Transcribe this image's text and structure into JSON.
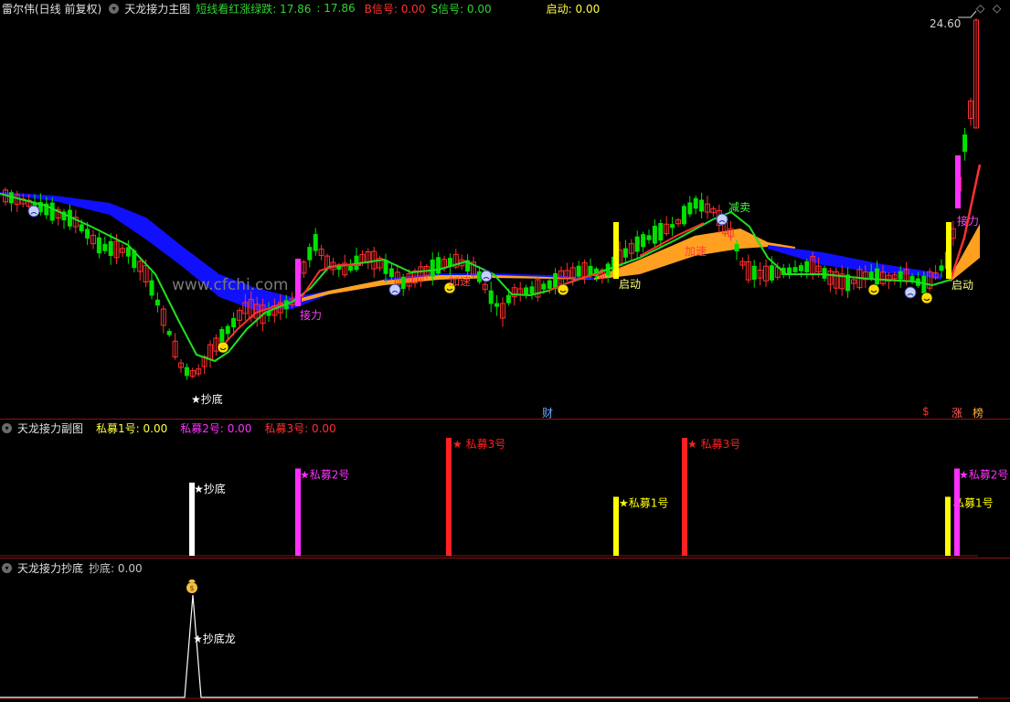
{
  "main": {
    "stock_name": "雷尔伟(日线 前复权)",
    "indicator": "天龙接力主图",
    "legend": [
      {
        "label": "短线看红涨绿跌: 17.86",
        "color": "#2fd62f"
      },
      {
        "label": ": 17.86",
        "color": "#2fd62f"
      },
      {
        "label": "B信号: 0.00",
        "color": "#ff3030"
      },
      {
        "label": "S信号: 0.00",
        "color": "#2fd62f"
      },
      {
        "label": "启动: 0.00",
        "color": "#ffff40"
      }
    ],
    "price_high_label": "24.60",
    "watermark": "www.cfchi.com",
    "annotations": {
      "chaodi": "★抄底",
      "jieli_1": "接力",
      "jieli_2": "接力",
      "qidong_1": "启动",
      "qidong_2": "启动",
      "jiasu": "加速",
      "jianmai": "减卖",
      "yuzhi": "加速"
    },
    "bottom_badges": [
      {
        "text": "财",
        "color": "#6aa8ff"
      },
      {
        "text": "$",
        "color": "#ff3030"
      },
      {
        "text": "涨",
        "color": "#ff6060"
      },
      {
        "text": "榜",
        "color": "#ffb040"
      }
    ]
  },
  "sub1": {
    "indicator": "天龙接力副图",
    "legend": [
      {
        "label": "私募1号: 0.00",
        "color": "#ffff40"
      },
      {
        "label": "私募2号: 0.00",
        "color": "#ff30ff"
      },
      {
        "label": "私募3号: 0.00",
        "color": "#ff3030"
      }
    ],
    "bars": [
      {
        "label": "★抄底",
        "color": "#ffffff",
        "value": 0.62
      },
      {
        "label": "★私募2号",
        "color": "#ff30ff",
        "value": 0.74
      },
      {
        "label": "★ 私募3号",
        "color": "#ff2020",
        "value": 1.0
      },
      {
        "label": "★私募1号",
        "color": "#ffff00",
        "value": 0.5
      },
      {
        "label": "★ 私募3号",
        "color": "#ff2020",
        "value": 1.0
      },
      {
        "label": "私募1号",
        "color": "#ffff00",
        "value": 0.5
      },
      {
        "label": "★私募2号",
        "color": "#ff30ff",
        "value": 0.74
      }
    ]
  },
  "sub2": {
    "indicator": "天龙接力抄底",
    "legend": [
      {
        "label": "抄底: 0.00",
        "color": "#c8c8c8"
      }
    ],
    "peak_label": "★抄底龙",
    "peak_icon": "money-bag-icon"
  },
  "colors": {
    "up": "#ff3030",
    "down": "#00e000",
    "band_blue": "#1010ff",
    "band_orange": "#ffa020",
    "line_green": "#20e020",
    "separator": "#8a1414"
  }
}
